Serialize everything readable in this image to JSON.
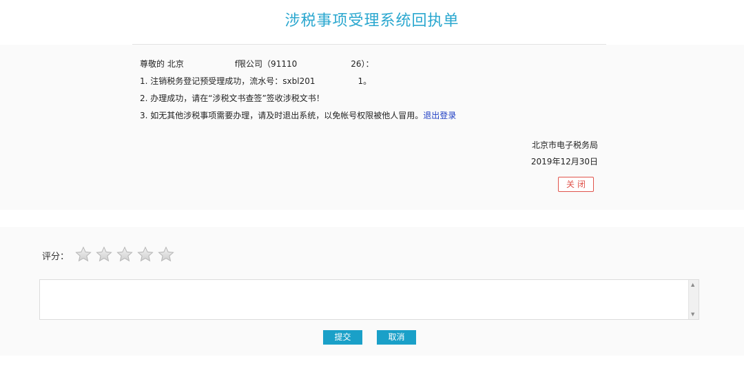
{
  "page_title": "涉税事项受理系统回执单",
  "receipt": {
    "salutation_prefix": "尊敬的 北京",
    "salutation_company_suffix": "f限公司（91110",
    "salutation_code_suffix": "26）：",
    "line1_prefix": "1. 注销税务登记预受理成功，流水号：sxbl201",
    "line1_suffix": "1。",
    "line2": "2. 办理成功，请在“涉税文书查签”签收涉税文书！",
    "line3": "3. 如无其他涉税事项需要办理，请及时退出系统，以免帐号权限被他人冒用。",
    "logout_link": "退出登录",
    "authority": "北京市电子税务局",
    "date": "2019年12月30日",
    "close_label": "关闭"
  },
  "rating": {
    "label": "评分：",
    "stars_total": 5,
    "stars_selected": 0,
    "star_icon": "star-icon",
    "colors": {
      "star_empty": "#d9d9d9",
      "accent": "#1aa0c8",
      "title": "#2aa7cf",
      "close_border": "#e0524a"
    }
  },
  "comment": {
    "value": "",
    "placeholder": ""
  },
  "actions": {
    "submit_label": "提交",
    "cancel_label": "取消"
  }
}
